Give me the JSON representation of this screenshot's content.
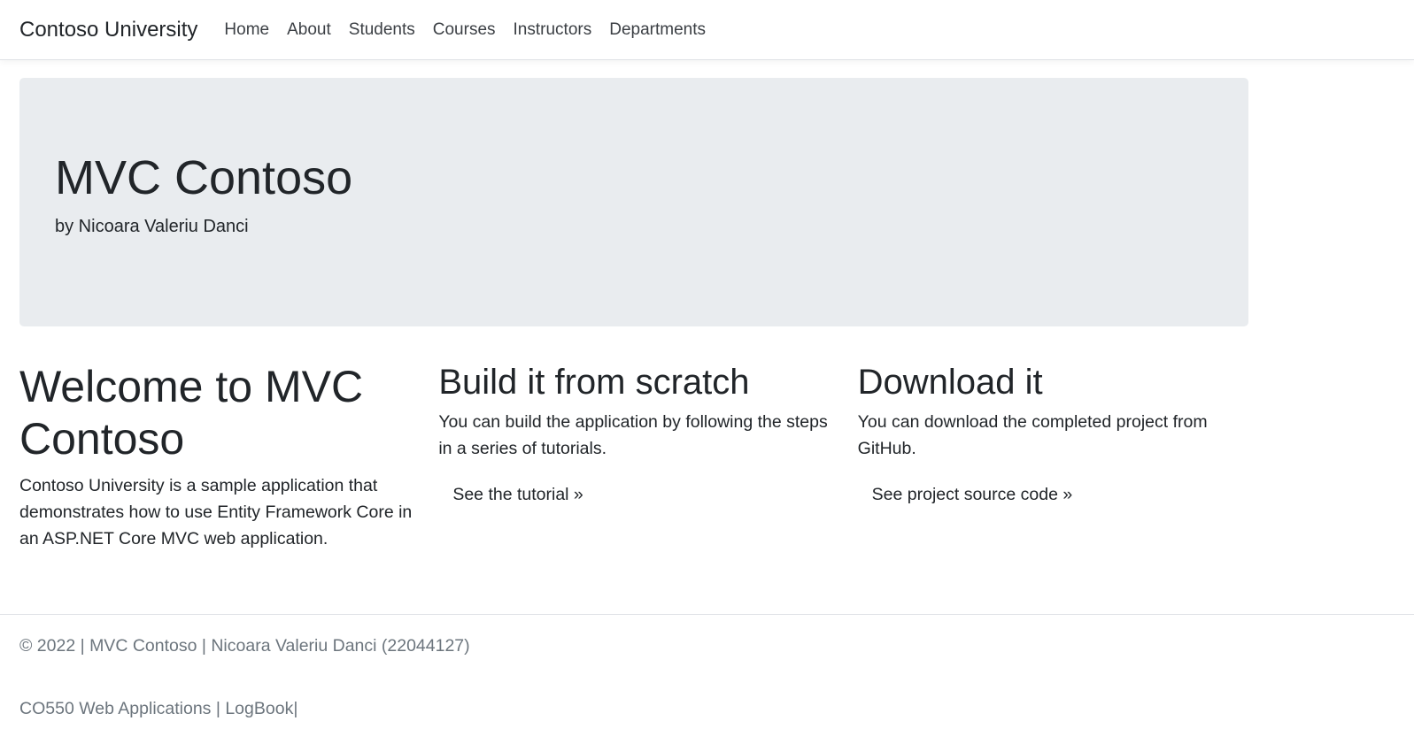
{
  "navbar": {
    "brand": "Contoso University",
    "links": [
      "Home",
      "About",
      "Students",
      "Courses",
      "Instructors",
      "Departments"
    ]
  },
  "jumbotron": {
    "title": "MVC Contoso",
    "subtitle": "by Nicoara Valeriu Danci"
  },
  "columns": [
    {
      "title": "Welcome to MVC Contoso",
      "text": "Contoso University is a sample application that demonstrates how to use Entity Framework Core in an ASP.NET Core MVC web application."
    },
    {
      "title": "Build it from scratch",
      "text": "You can build the application by following the steps in a series of tutorials.",
      "link": "See the tutorial »"
    },
    {
      "title": "Download it",
      "text": "You can download the completed project from GitHub.",
      "link": "See project source code »"
    }
  ],
  "footer": {
    "line1": "© 2022 | MVC Contoso | Nicoara Valeriu Danci (22044127)",
    "line2": "CO550 Web Applications | LogBook|"
  },
  "colors": {
    "jumbotron_bg": "#e9ecef",
    "text": "#212529",
    "footer_text": "#6c757d"
  }
}
